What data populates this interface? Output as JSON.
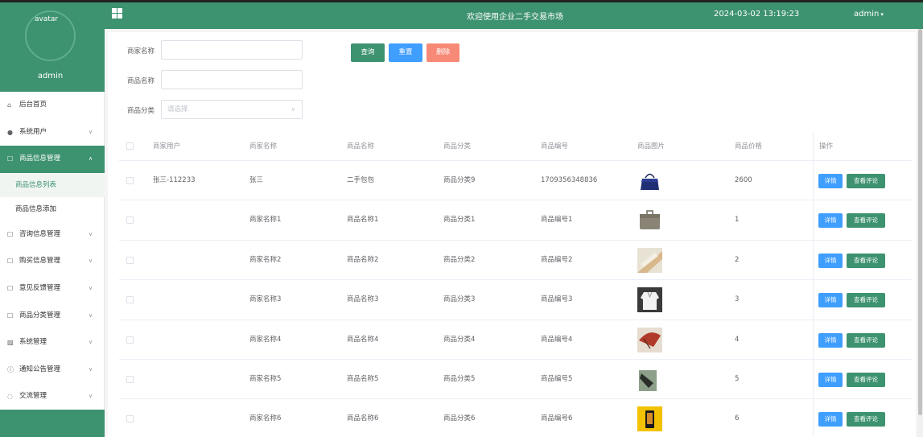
{
  "header": {
    "title": "欢迎使用企业二手交易市场",
    "datetime": "2024-03-02 13:19:23",
    "user": "admin"
  },
  "sidebar": {
    "avatar_alt": "avatar",
    "username": "admin",
    "items": [
      {
        "label": "后台首页",
        "icon": "home-icon"
      },
      {
        "label": "系统用户",
        "icon": "user-icon"
      },
      {
        "label": "商品信息管理",
        "icon": "doc-icon",
        "expanded": true
      },
      {
        "label": "咨询信息管理",
        "icon": "doc-icon"
      },
      {
        "label": "购买信息管理",
        "icon": "doc-icon"
      },
      {
        "label": "意见反馈管理",
        "icon": "doc-icon"
      },
      {
        "label": "商品分类管理",
        "icon": "doc-icon"
      },
      {
        "label": "系统管理",
        "icon": "image-icon"
      },
      {
        "label": "通知公告管理",
        "icon": "info-icon"
      },
      {
        "label": "交流管理",
        "icon": "chat-icon"
      }
    ],
    "subitems": [
      {
        "label": "商品信息列表",
        "active": true
      },
      {
        "label": "商品信息添加"
      }
    ]
  },
  "search": {
    "merchant_label": "商家名称",
    "merchant_value": "",
    "product_label": "商品名称",
    "product_value": "",
    "category_label": "商品分类",
    "category_placeholder": "请选择",
    "search_btn": "查询",
    "reset_btn": "重置",
    "delete_btn": "删除"
  },
  "table": {
    "headers": [
      "商家用户",
      "商家名称",
      "商品名称",
      "商品分类",
      "商品编号",
      "商品图片",
      "商品价格",
      "操作"
    ],
    "detail_btn": "详情",
    "review_btn": "查看评论",
    "rows": [
      {
        "user": "张三-112233",
        "merchant": "张三",
        "name": "二手包包",
        "category": "商品分类9",
        "code": "1709356348836",
        "price": "2600"
      },
      {
        "user": "",
        "merchant": "商家名称1",
        "name": "商品名称1",
        "category": "商品分类1",
        "code": "商品编号1",
        "price": "1"
      },
      {
        "user": "",
        "merchant": "商家名称2",
        "name": "商品名称2",
        "category": "商品分类2",
        "code": "商品编号2",
        "price": "2"
      },
      {
        "user": "",
        "merchant": "商家名称3",
        "name": "商品名称3",
        "category": "商品分类3",
        "code": "商品编号3",
        "price": "3"
      },
      {
        "user": "",
        "merchant": "商家名称4",
        "name": "商品名称4",
        "category": "商品分类4",
        "code": "商品编号4",
        "price": "4"
      },
      {
        "user": "",
        "merchant": "商家名称5",
        "name": "商品名称5",
        "category": "商品分类5",
        "code": "商品编号5",
        "price": "5"
      },
      {
        "user": "",
        "merchant": "商家名称6",
        "name": "商品名称6",
        "category": "商品分类6",
        "code": "商品编号6",
        "price": "6"
      }
    ]
  },
  "colors": {
    "primary": "#3d9270",
    "info": "#409eff",
    "danger": "#f78977"
  }
}
